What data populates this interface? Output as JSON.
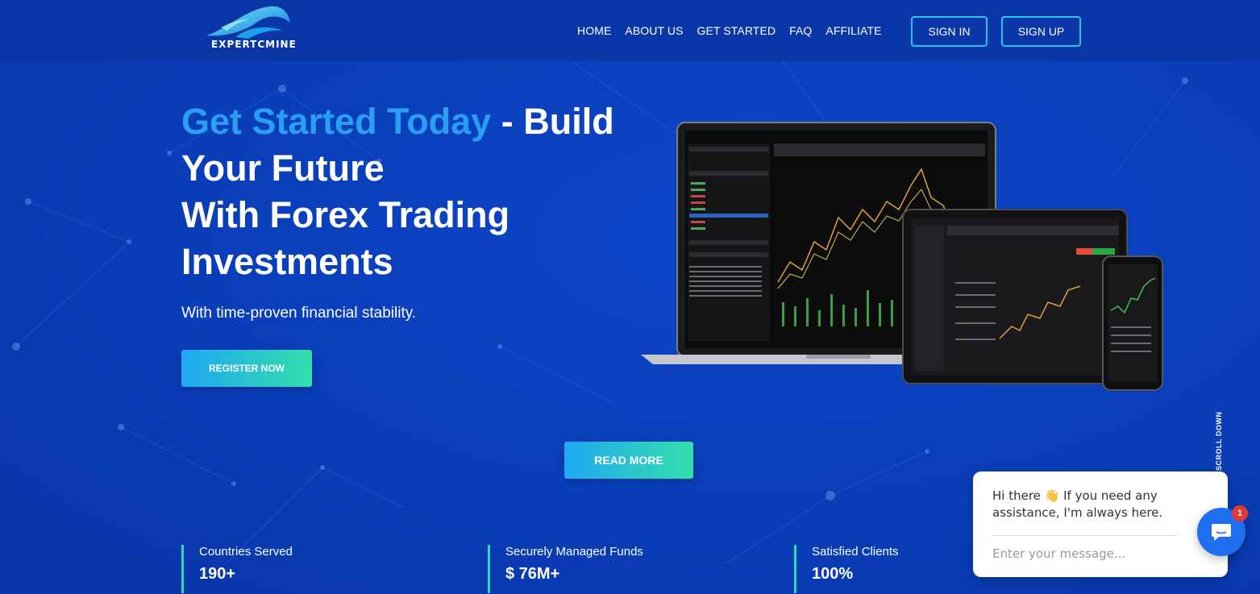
{
  "brand": {
    "name": "EXPERTCMINE"
  },
  "nav": {
    "items": [
      "HOME",
      "ABOUT US",
      "GET STARTED",
      "FAQ",
      "AFFILIATE"
    ],
    "signin": "SIGN IN",
    "signup": "SIGN UP"
  },
  "hero": {
    "title_accent": "Get Started Today",
    "title_rest_1": " - Build",
    "title_rest_2": "Your Future",
    "title_rest_3": "With Forex Trading",
    "title_rest_4": "Investments",
    "subtitle": "With time-proven financial stability.",
    "register": "REGISTER NOW",
    "readmore": "READ MORE"
  },
  "scroll": "SCROLL DOWN",
  "stats": [
    {
      "label": "Countries Served",
      "value": "190+"
    },
    {
      "label": "Securely Managed Funds",
      "value": "$ 76M+"
    },
    {
      "label": "Satisfied Clients",
      "value": "100%"
    }
  ],
  "chat": {
    "message": "Hi there 👋 If you need any assistance, I'm always here.",
    "placeholder": "Enter your message...",
    "badge": "1"
  },
  "colors": {
    "background": "#0a3fc0",
    "accent": "#2a9ff2",
    "gradient_start": "#20a7f2",
    "gradient_end": "#33dfaa",
    "outline_button": "#23c8e8"
  },
  "icons": [
    "logo-wave-icon",
    "chat-bubble-icon"
  ]
}
